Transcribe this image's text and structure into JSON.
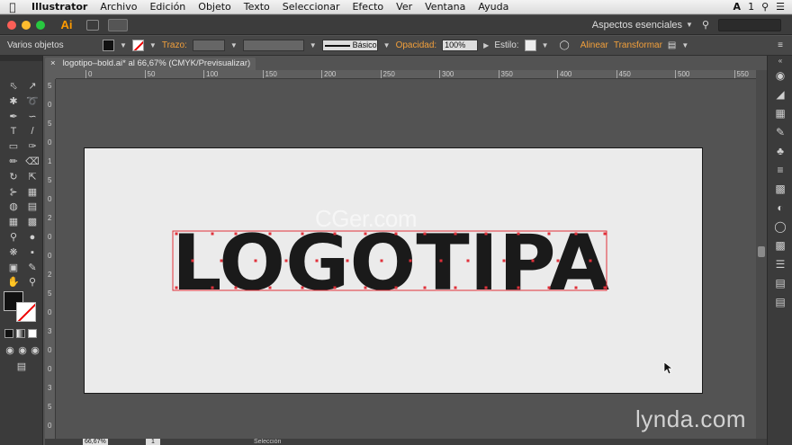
{
  "menubar": {
    "app_name": "Illustrator",
    "items": [
      "Archivo",
      "Edición",
      "Objeto",
      "Texto",
      "Seleccionar",
      "Efecto",
      "Ver",
      "Ventana",
      "Ayuda"
    ],
    "badge": "1"
  },
  "appbar": {
    "app_badge": "Ai",
    "workspace": "Aspectos esenciales"
  },
  "control": {
    "selection_label": "Varios objetos",
    "stroke_label": "Trazo:",
    "stroke_style": "Básico",
    "opacity_label": "Opacidad:",
    "opacity_value": "100%",
    "style_label": "Estilo:",
    "align_label": "Alinear",
    "transform_label": "Transformar"
  },
  "document": {
    "tab_title": "logotipo–bold.ai* al 66,67% (CMYK/Previsualizar)",
    "close_glyph": "×"
  },
  "ruler": {
    "h_ticks": [
      "0",
      "50",
      "100",
      "150",
      "200",
      "250",
      "300",
      "350",
      "400",
      "450",
      "500",
      "550"
    ],
    "v_ticks": [
      "5",
      "0",
      "5",
      "0",
      "1",
      "5",
      "0",
      "2",
      "0",
      "0",
      "2",
      "5",
      "0",
      "3",
      "0",
      "0",
      "3",
      "5",
      "0"
    ]
  },
  "artwork": {
    "word": "LOGOTIPA",
    "fill": "#1a1a1a",
    "selection_color": "#e0303a"
  },
  "watermark": "CGer.com",
  "brand_watermark": "lynda.com",
  "status": {
    "zoom": "66,67%",
    "page": "1",
    "tool": "Selección"
  },
  "colors": {
    "accent_orange": "#f3a03b",
    "artboard": "#ebebeb",
    "canvas": "#535353"
  }
}
